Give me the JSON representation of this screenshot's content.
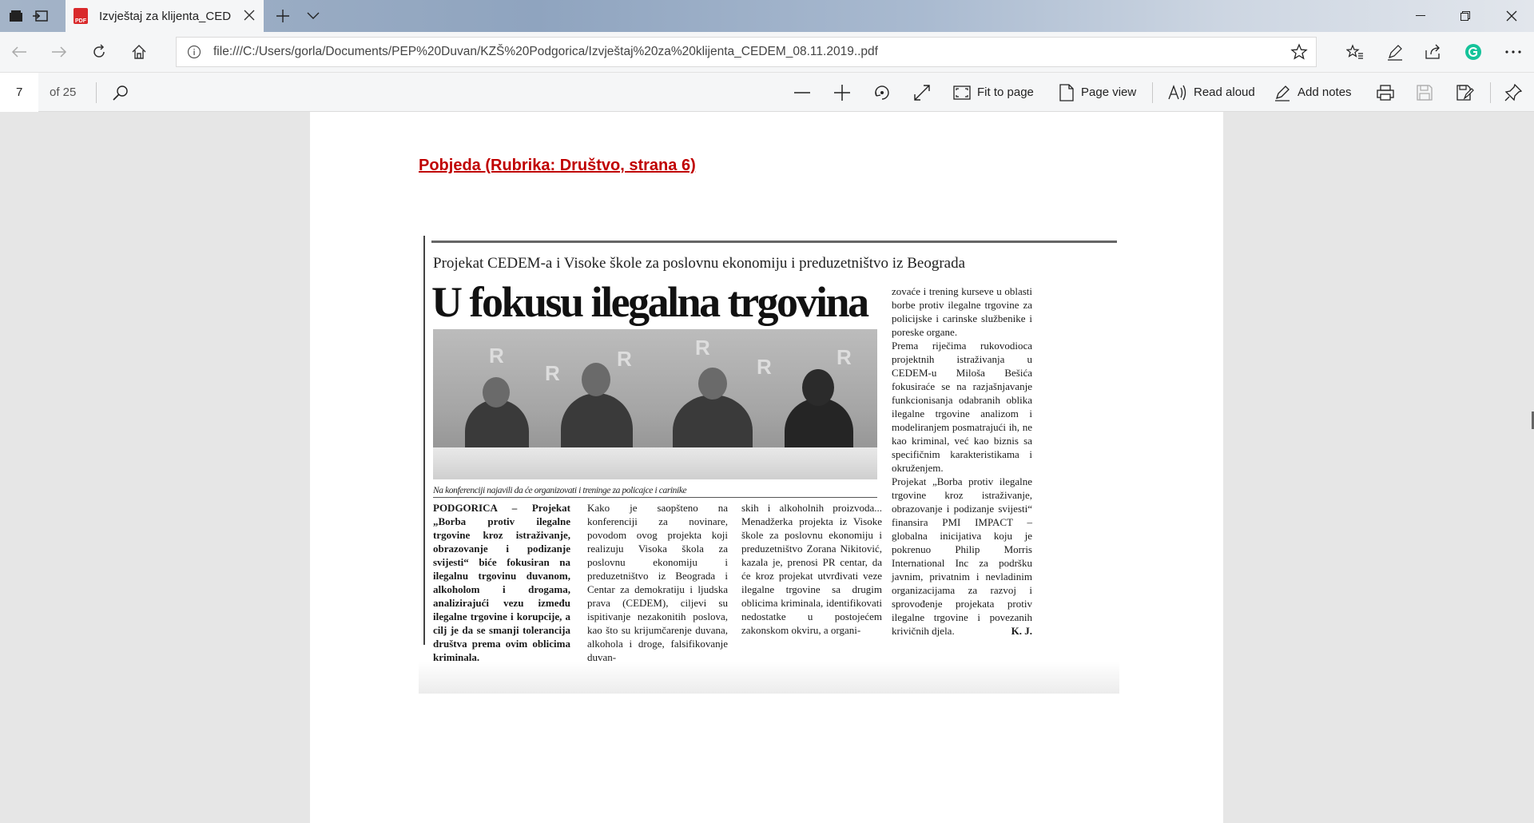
{
  "browser": {
    "tab_title": "Izvještaj za klijenta_CED",
    "tab_icon": "pdf-icon",
    "url": "file:///C:/Users/gorla/Documents/PEP%20Duvan/KZŠ%20Podgorica/Izvještaj%20za%20klijenta_CEDEM_08.11.2019..pdf"
  },
  "pdf_toolbar": {
    "current_page": "7",
    "total_pages": "of 25",
    "fit_to_page": "Fit to page",
    "page_view": "Page view",
    "read_aloud": "Read aloud",
    "add_notes": "Add notes"
  },
  "document": {
    "source_link": "Pobjeda (Rubrika: Društvo, strana 6)",
    "article": {
      "kicker": "Projekat CEDEM-a i Visoke škole za poslovnu ekonomiju i preduzetništvo iz Beograda",
      "headline": "U fokusu ilegalna trgovina",
      "photo_caption": "Na konferenciji najavili da će organizovati i treninge za policajce i carinike",
      "lead_dateline": "PODGORICA",
      "lead_text": " – Projekat „Borba protiv ilegalne trgovine kroz istraživanje, obrazovanje i podizanje svijesti“ biće fokusiran na ilegalnu trgovinu duvanom, alkoholom i drogama, analizirajući vezu između ilegalne trgovine i korupcije, a cilj je da se smanji tolerancija društva prema ovim oblicima kriminala.",
      "col2": "Kako je saopšteno na konferenciji za novinare, povodom ovog projekta koji realizuju Visoka škola za poslovnu ekonomiju i preduzetništvo iz Beograda i Centar za demokratiju i ljudska prava (CEDEM), ciljevi su ispitivanje nezakonitih poslova, kao što su krijumčarenje duvana, alkohola i droge, falsifikovanje duvan-",
      "col3": "skih i alkoholnih proizvoda... Menadžerka projekta iz Visoke škole za poslovnu ekonomiju i preduzetništvo Zorana Nikitović, kazala je, prenosi PR centar, da će kroz projekat utvrđivati veze ilegalne trgovine sa drugim oblicima kriminala, identifikovati nedostatke u postojećem zakonskom okviru, a organi-",
      "col4_p1": "zovaće i trening kurseve u oblasti borbe protiv ilegalne trgovine za policijske i carinske službenike i poreske organe.",
      "col4_p2": "Prema riječima rukovodioca projektnih istraživanja u CEDEM-u Miloša Bešića fokusiraće se na razjašnjavanje funkcionisanja odabranih oblika ilegalne trgovine analizom i modeliranjem posmatrajući ih, ne kao kriminal, već kao biznis sa specifičnim karakteristikama i okruženjem.",
      "col4_p3": "Projekat „Borba protiv ilegalne trgovine kroz istraživanje, obrazovanje i podizanje svijesti“ finansira PMI IMPACT – globalna inicijativa koju je pokrenuo Philip Morris International Inc za podršku javnim, privatnim i nevladinim organizacijama za razvoj i sprovođenje projekata protiv ilegalne trgovine i povezanih krivičnih djela.",
      "signature": "K. J."
    }
  },
  "colors": {
    "link_red": "#c00000",
    "grammarly_green": "#15c39a",
    "pdf_red": "#d9292b"
  }
}
